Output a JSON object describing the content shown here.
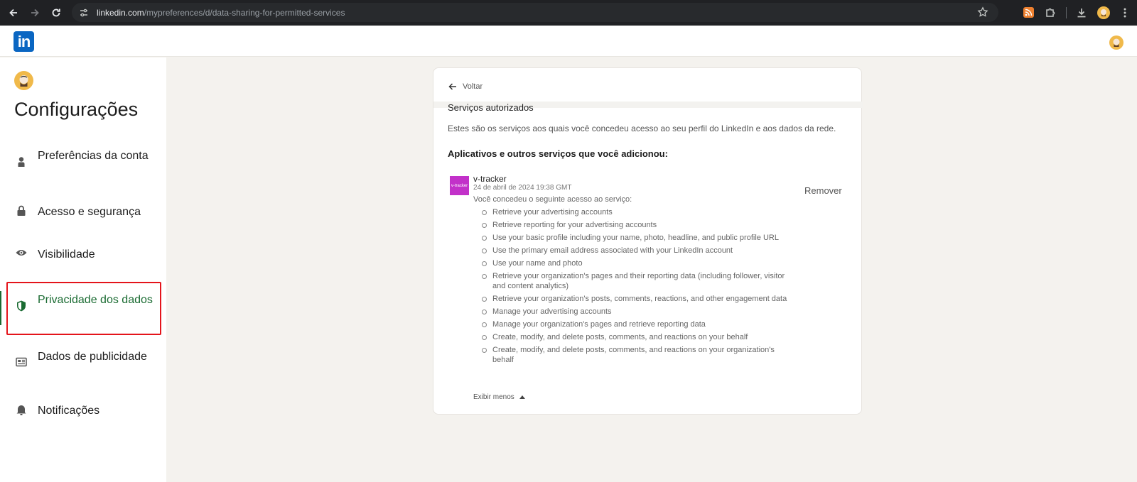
{
  "browser": {
    "url_host": "linkedin.com",
    "url_path": "/mypreferences/d/data-sharing-for-permitted-services"
  },
  "header": {
    "logo_text": "in"
  },
  "sidebar": {
    "title": "Configurações",
    "items": [
      {
        "label": "Preferências da conta",
        "icon": "person-icon"
      },
      {
        "label": "Acesso e segurança",
        "icon": "lock-icon"
      },
      {
        "label": "Visibilidade",
        "icon": "eye-icon"
      },
      {
        "label": "Privacidade dos dados",
        "icon": "shield-icon",
        "active": true
      },
      {
        "label": "Dados de publicidade",
        "icon": "newspaper-icon"
      },
      {
        "label": "Notificações",
        "icon": "bell-icon"
      }
    ]
  },
  "main": {
    "back_label": "Voltar",
    "section_title": "Serviços autorizados",
    "section_desc": "Estes são os serviços aos quais você concedeu acesso ao seu perfil do LinkedIn e aos dados da rede.",
    "subheading": "Aplicativos e outros serviços que você adicionou:",
    "app": {
      "logo_text": "v-tracker",
      "name": "v-tracker",
      "date": "24 de abril de 2024 19:38 GMT",
      "intro": "Você concedeu o seguinte acesso ao serviço:",
      "remove_label": "Remover",
      "permissions": [
        "Retrieve your advertising accounts",
        "Retrieve reporting for your advertising accounts",
        "Use your basic profile including your name, photo, headline, and public profile URL",
        "Use the primary email address associated with your LinkedIn account",
        "Use your name and photo",
        "Retrieve your organization's pages and their reporting data (including follower, visitor and content analytics)",
        "Retrieve your organization's posts, comments, reactions, and other engagement data",
        "Manage your advertising accounts",
        "Manage your organization's pages and retrieve reporting data",
        "Create, modify, and delete posts, comments, and reactions on your behalf",
        "Create, modify, and delete posts, comments, and reactions on your organization's behalf"
      ],
      "show_less_label": "Exibir menos"
    }
  },
  "colors": {
    "linkedin_blue": "#0a66c2",
    "active_green": "#1a6b32",
    "highlight_red": "#e4141b",
    "app_logo_bg": "#c231c9"
  }
}
